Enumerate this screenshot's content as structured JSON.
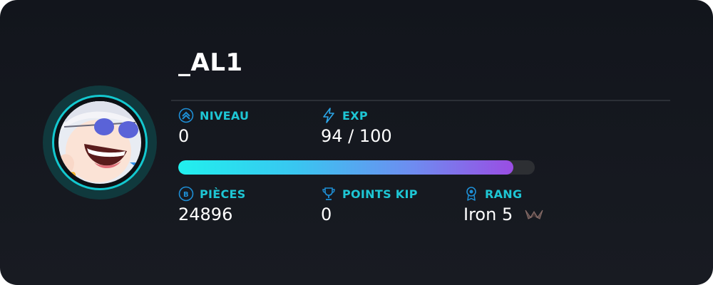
{
  "profile": {
    "username": "_AL1",
    "avatar_icon": "anime-character-avatar"
  },
  "stats": {
    "level": {
      "label": "NIVEAU",
      "value": "0",
      "icon": "chevron-up-circle-icon"
    },
    "exp": {
      "label": "EXP",
      "value": "94 / 100",
      "icon": "lightning-bolt-icon"
    },
    "coins": {
      "label": "PIÈCES",
      "value": "24896",
      "icon": "coin-icon"
    },
    "kip_points": {
      "label": "POINTS KIP",
      "value": "0",
      "icon": "trophy-icon"
    },
    "rank": {
      "label": "RANG",
      "value": "Iron 5",
      "icon": "rank-badge-icon",
      "emblem": "iron-rank-emblem"
    }
  },
  "progress": {
    "exp_fraction": 0.94
  },
  "colors": {
    "accent": "#1ec6d4",
    "background": "#15181f",
    "bar_start": "#21f0ee",
    "bar_end": "#9a4de3"
  }
}
